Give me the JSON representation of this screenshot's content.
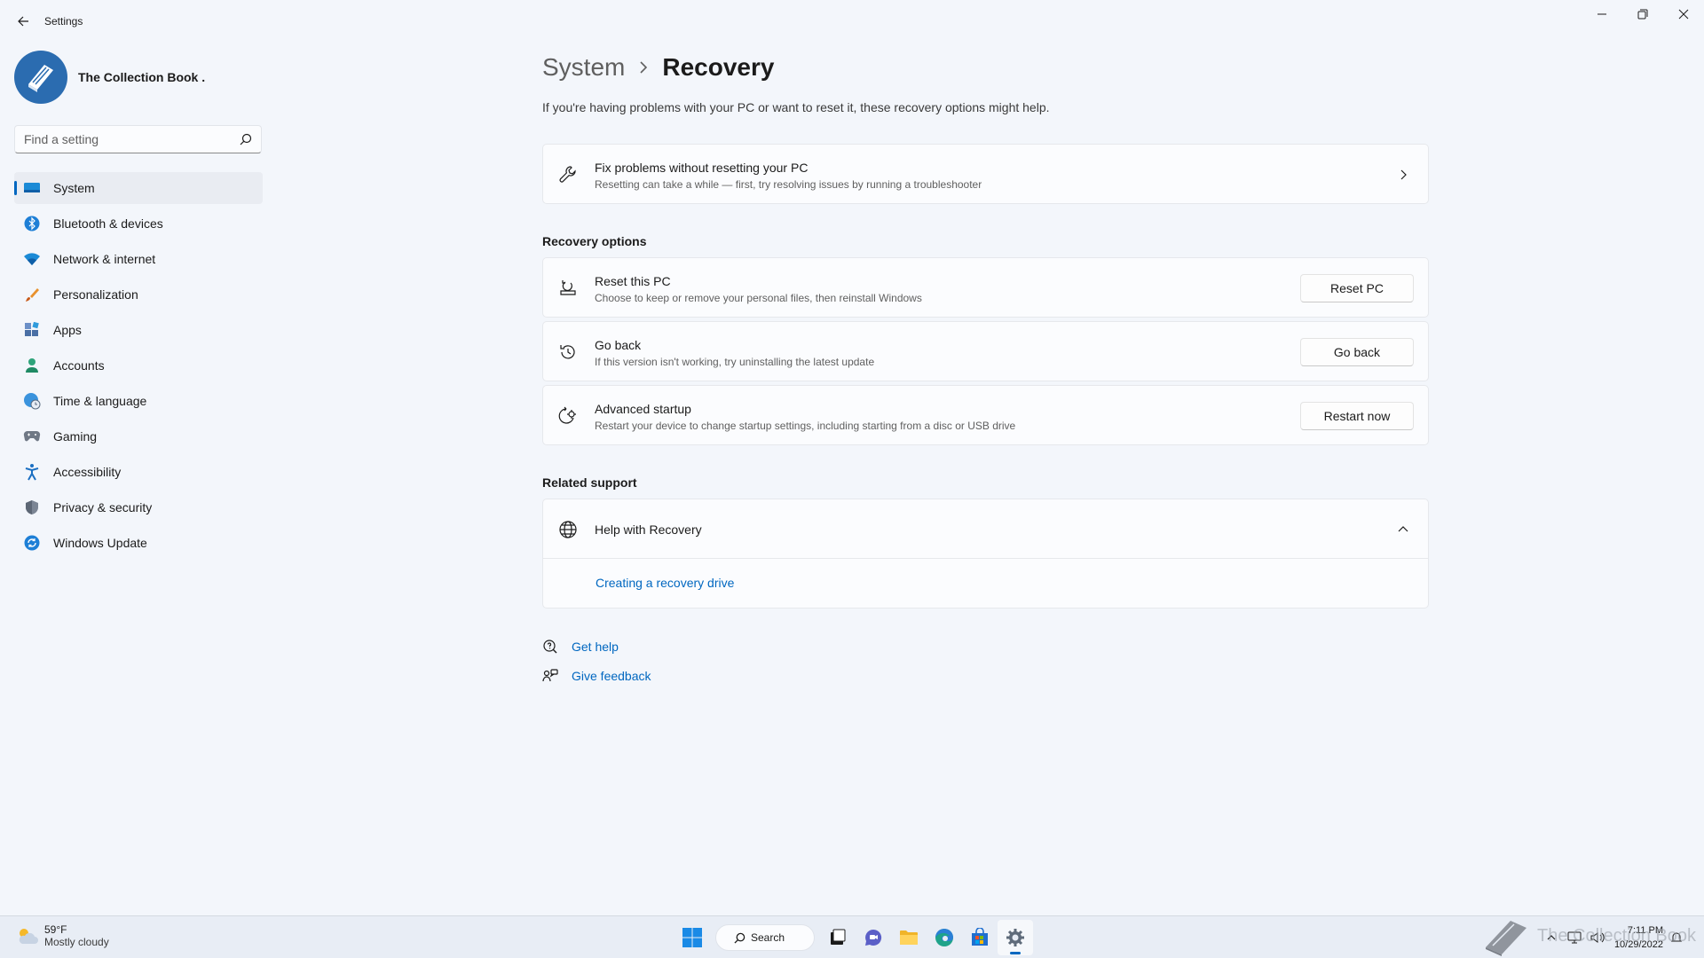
{
  "window": {
    "title": "Settings"
  },
  "profile": {
    "name": "The Collection Book ."
  },
  "search": {
    "placeholder": "Find a setting"
  },
  "sidebar": {
    "items": [
      {
        "label": "System",
        "icon": "system-icon",
        "active": true
      },
      {
        "label": "Bluetooth & devices",
        "icon": "bluetooth-icon"
      },
      {
        "label": "Network & internet",
        "icon": "wifi-icon"
      },
      {
        "label": "Personalization",
        "icon": "brush-icon"
      },
      {
        "label": "Apps",
        "icon": "apps-icon"
      },
      {
        "label": "Accounts",
        "icon": "person-icon"
      },
      {
        "label": "Time & language",
        "icon": "globe-clock-icon"
      },
      {
        "label": "Gaming",
        "icon": "gamepad-icon"
      },
      {
        "label": "Accessibility",
        "icon": "accessibility-icon"
      },
      {
        "label": "Privacy & security",
        "icon": "shield-icon"
      },
      {
        "label": "Windows Update",
        "icon": "update-icon"
      }
    ]
  },
  "main": {
    "breadcrumb_parent": "System",
    "breadcrumb_current": "Recovery",
    "subtitle": "If you're having problems with your PC or want to reset it, these recovery options might help.",
    "fix_card": {
      "title": "Fix problems without resetting your PC",
      "desc": "Resetting can take a while — first, try resolving issues by running a troubleshooter"
    },
    "recovery_options_title": "Recovery options",
    "options": [
      {
        "title": "Reset this PC",
        "desc": "Choose to keep or remove your personal files, then reinstall Windows",
        "button": "Reset PC"
      },
      {
        "title": "Go back",
        "desc": "If this version isn't working, try uninstalling the latest update",
        "button": "Go back"
      },
      {
        "title": "Advanced startup",
        "desc": "Restart your device to change startup settings, including starting from a disc or USB drive",
        "button": "Restart now"
      }
    ],
    "related_support_title": "Related support",
    "help_expander": {
      "title": "Help with Recovery",
      "link": "Creating a recovery drive"
    },
    "get_help": "Get help",
    "give_feedback": "Give feedback"
  },
  "taskbar": {
    "weather_temp": "59°F",
    "weather_condition": "Mostly cloudy",
    "search_label": "Search",
    "time": "7:11 PM",
    "date": "10/29/2022",
    "watermark": "The Collection Book"
  },
  "colors": {
    "accent": "#0067c0",
    "background": "#f3f6fb",
    "card": "#fbfcfe"
  }
}
